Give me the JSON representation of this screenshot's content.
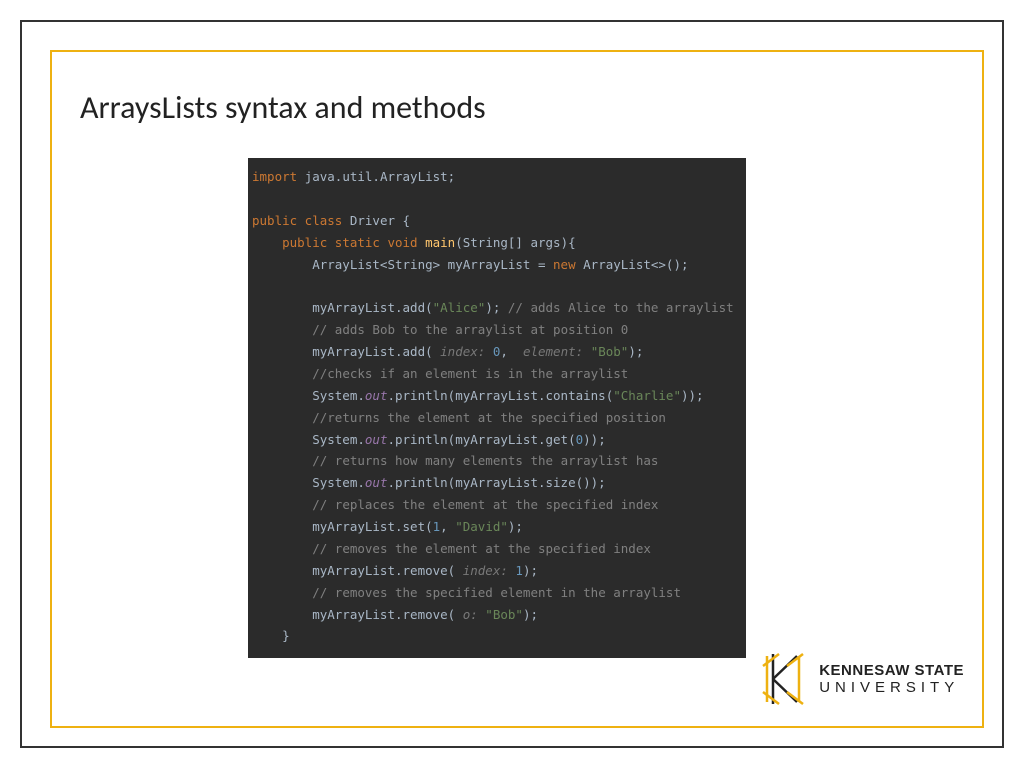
{
  "title": "ArraysLists syntax and methods",
  "logo": {
    "line1": "KENNESAW STATE",
    "line2": "UNIVERSITY"
  },
  "code": {
    "tokens": [
      [
        {
          "t": "kw",
          "v": "import "
        },
        {
          "t": "",
          "v": "java.util.ArrayList;"
        }
      ],
      [
        {
          "t": "",
          "v": ""
        }
      ],
      [
        {
          "t": "kw",
          "v": "public class "
        },
        {
          "t": "",
          "v": "Driver {"
        }
      ],
      [
        {
          "t": "",
          "v": "    "
        },
        {
          "t": "kw",
          "v": "public static void "
        },
        {
          "t": "fn",
          "v": "main"
        },
        {
          "t": "",
          "v": "(String[] args){"
        }
      ],
      [
        {
          "t": "",
          "v": "        ArrayList<String> myArrayList = "
        },
        {
          "t": "kw",
          "v": "new "
        },
        {
          "t": "",
          "v": "ArrayList<>();"
        }
      ],
      [
        {
          "t": "",
          "v": ""
        }
      ],
      [
        {
          "t": "",
          "v": "        myArrayList.add("
        },
        {
          "t": "str",
          "v": "\"Alice\""
        },
        {
          "t": "",
          "v": "); "
        },
        {
          "t": "cmt",
          "v": "// adds Alice to the arraylist"
        }
      ],
      [
        {
          "t": "",
          "v": "        "
        },
        {
          "t": "cmt",
          "v": "// adds Bob to the arraylist at position 0"
        }
      ],
      [
        {
          "t": "",
          "v": "        myArrayList.add( "
        },
        {
          "t": "hint",
          "v": "index: "
        },
        {
          "t": "num",
          "v": "0"
        },
        {
          "t": "",
          "v": ",  "
        },
        {
          "t": "hint",
          "v": "element: "
        },
        {
          "t": "str",
          "v": "\"Bob\""
        },
        {
          "t": "",
          "v": ");"
        }
      ],
      [
        {
          "t": "",
          "v": "        "
        },
        {
          "t": "cmt",
          "v": "//checks if an element is in the arraylist"
        }
      ],
      [
        {
          "t": "",
          "v": "        System."
        },
        {
          "t": "field",
          "v": "out"
        },
        {
          "t": "",
          "v": ".println(myArrayList.contains("
        },
        {
          "t": "str",
          "v": "\"Charlie\""
        },
        {
          "t": "",
          "v": "));"
        }
      ],
      [
        {
          "t": "",
          "v": "        "
        },
        {
          "t": "cmt",
          "v": "//returns the element at the specified position"
        }
      ],
      [
        {
          "t": "",
          "v": "        System."
        },
        {
          "t": "field",
          "v": "out"
        },
        {
          "t": "",
          "v": ".println(myArrayList.get("
        },
        {
          "t": "num",
          "v": "0"
        },
        {
          "t": "",
          "v": "));"
        }
      ],
      [
        {
          "t": "",
          "v": "        "
        },
        {
          "t": "cmt",
          "v": "// returns how many elements the arraylist has"
        }
      ],
      [
        {
          "t": "",
          "v": "        System."
        },
        {
          "t": "field",
          "v": "out"
        },
        {
          "t": "",
          "v": ".println(myArrayList.size());"
        }
      ],
      [
        {
          "t": "",
          "v": "        "
        },
        {
          "t": "cmt",
          "v": "// replaces the element at the specified index"
        }
      ],
      [
        {
          "t": "",
          "v": "        myArrayList.set("
        },
        {
          "t": "num",
          "v": "1"
        },
        {
          "t": "",
          "v": ", "
        },
        {
          "t": "str",
          "v": "\"David\""
        },
        {
          "t": "",
          "v": ");"
        }
      ],
      [
        {
          "t": "",
          "v": "        "
        },
        {
          "t": "cmt",
          "v": "// removes the element at the specified index"
        }
      ],
      [
        {
          "t": "",
          "v": "        myArrayList.remove( "
        },
        {
          "t": "hint",
          "v": "index: "
        },
        {
          "t": "num",
          "v": "1"
        },
        {
          "t": "",
          "v": ");"
        }
      ],
      [
        {
          "t": "",
          "v": "        "
        },
        {
          "t": "cmt",
          "v": "// removes the specified element in the arraylist"
        }
      ],
      [
        {
          "t": "",
          "v": "        myArrayList.remove( "
        },
        {
          "t": "hint",
          "v": "o: "
        },
        {
          "t": "str",
          "v": "\"Bob\""
        },
        {
          "t": "",
          "v": ");"
        }
      ],
      [
        {
          "t": "",
          "v": "    }"
        }
      ]
    ]
  }
}
